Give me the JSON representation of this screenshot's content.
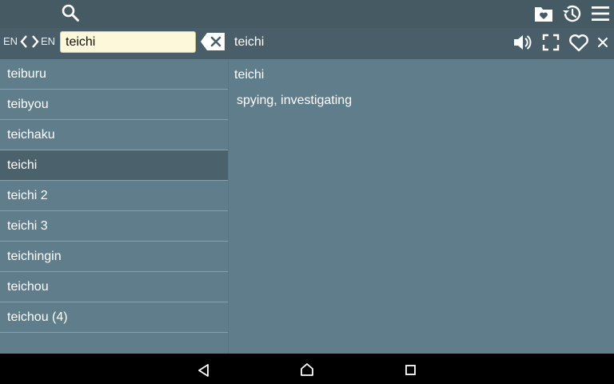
{
  "toolbar": {
    "source_lang": "EN",
    "target_lang": "EN",
    "search_value": "teichi",
    "search_placeholder": "",
    "icons": [
      "search-icon",
      "folder-heart-icon",
      "history-icon",
      "menu-icon"
    ]
  },
  "detail_bar": {
    "title": "teichi",
    "icons": [
      "speaker-icon",
      "fullscreen-icon",
      "heart-icon",
      "close-icon"
    ]
  },
  "word_list": {
    "items": [
      {
        "label": "teiburu",
        "selected": false
      },
      {
        "label": "teibyou",
        "selected": false
      },
      {
        "label": "teichaku",
        "selected": false
      },
      {
        "label": "teichi",
        "selected": true
      },
      {
        "label": "teichi 2",
        "selected": false
      },
      {
        "label": "teichi 3",
        "selected": false
      },
      {
        "label": "teichingin",
        "selected": false
      },
      {
        "label": "teichou",
        "selected": false
      },
      {
        "label": "teichou (4)",
        "selected": false
      }
    ]
  },
  "entry": {
    "headword": "teichi",
    "definition": "spying, investigating"
  },
  "colors": {
    "appbar": "#465a64",
    "pane": "#607d8b",
    "selected": "#4b626d",
    "input_bg": "#fdf8d9"
  },
  "navbar": {
    "icons": [
      "back-icon",
      "home-icon",
      "recents-icon"
    ]
  }
}
